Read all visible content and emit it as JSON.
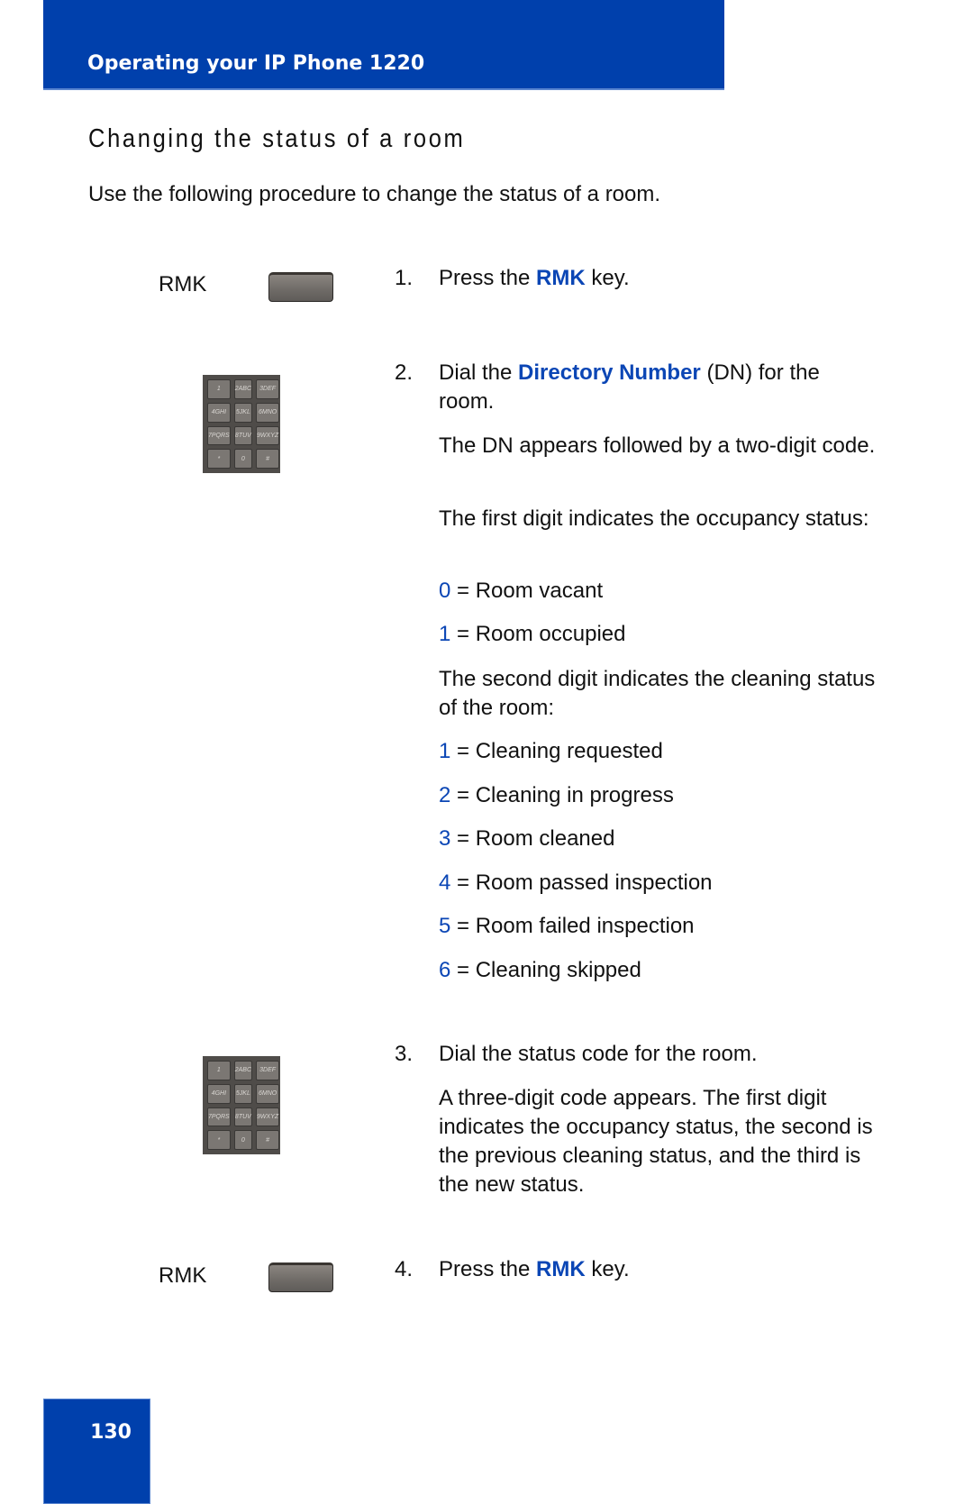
{
  "header": {
    "title": "Operating your IP Phone 1220",
    "accent_color": "#0040ac"
  },
  "section": {
    "title": "Changing the status of a room",
    "intro": "Use the following procedure to change the status of a room."
  },
  "keys": {
    "rmk_label": "RMK",
    "rmk_icon": "soft-key-icon",
    "keypad_icon": "dialpad-icon",
    "keypad_keys": [
      "1",
      "2ABC",
      "3DEF",
      "4GHI",
      "5JKL",
      "6MNO",
      "7PQRS",
      "8TUV",
      "9WXYZ",
      "*",
      "0",
      "#"
    ]
  },
  "steps": [
    {
      "number": "1.",
      "pre": "Press the ",
      "highlight": "RMK",
      "post": " key."
    },
    {
      "number": "2.",
      "pre": "Dial the ",
      "highlight": "Directory Number",
      "post": " (DN) for the room.",
      "paragraphs": [
        "The DN appears followed by a two-digit code.",
        "The first digit indicates the occupancy status:"
      ],
      "occupancy_codes": [
        {
          "code": "0",
          "label": "= Room vacant"
        },
        {
          "code": "1",
          "label": "= Room occupied"
        }
      ],
      "cleaning_intro": "The second digit indicates the cleaning status of the room:",
      "cleaning_codes": [
        {
          "code": "1",
          "label": "= Cleaning requested"
        },
        {
          "code": "2",
          "label": "= Cleaning in progress"
        },
        {
          "code": "3",
          "label": "= Room cleaned"
        },
        {
          "code": "4",
          "label": "= Room passed inspection"
        },
        {
          "code": "5",
          "label": "= Room failed inspection"
        },
        {
          "code": "6",
          "label": "= Cleaning skipped"
        }
      ]
    },
    {
      "number": "3.",
      "text": "Dial the status code for the room.",
      "paragraph": "A three-digit code appears. The first digit indicates the occupancy status, the second is the previous cleaning status, and the third is the new status."
    },
    {
      "number": "4.",
      "pre": "Press the ",
      "highlight": "RMK",
      "post": " key."
    }
  ],
  "footer": {
    "page_number": "130"
  }
}
